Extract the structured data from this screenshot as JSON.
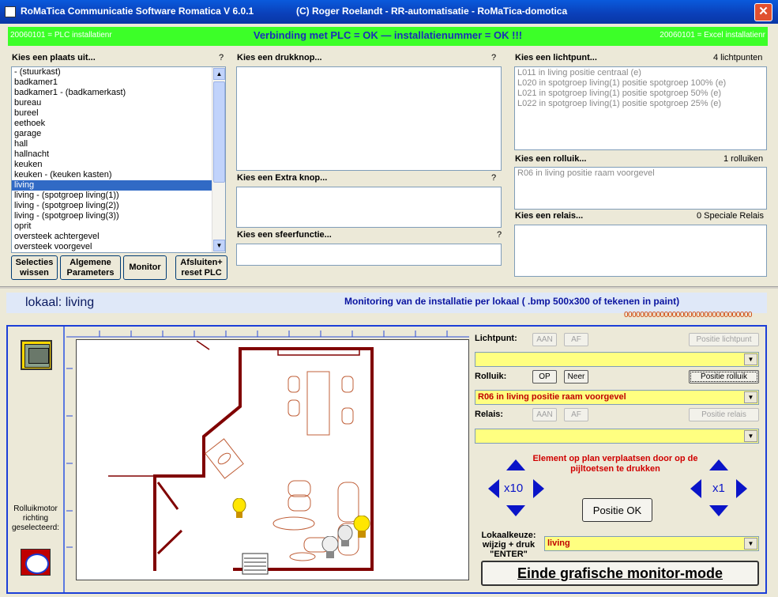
{
  "window": {
    "title_left": "RoMaTica Communicatie Software Romatica V 6.0.1",
    "title_right": "(C) Roger Roelandt - RR-automatisatie - RoMaTica-domotica",
    "close_label": "✕"
  },
  "status": {
    "left": "20060101 = PLC installatienr",
    "center": "Verbinding met PLC = OK  —  installatienummer = OK !!!",
    "right": "20060101 = Excel installatienr"
  },
  "places": {
    "label": "Kies een plaats uit...",
    "help": "?",
    "items": [
      "- (stuurkast)",
      "badkamer1",
      "badkamer1 - (badkamerkast)",
      "bureau",
      "bureel",
      "eethoek",
      "garage",
      "hall",
      "hallnacht",
      "keuken",
      "keuken - (keuken kasten)",
      "living",
      "living - (spotgroep living(1))",
      "living - (spotgroep living(2))",
      "living - (spotgroep living(3))",
      "oprit",
      "oversteek achtergevel",
      "oversteek voorgevel"
    ],
    "selected": "living"
  },
  "buttons": {
    "selecties": "Selecties wissen",
    "algemene": "Algemene Parameters",
    "monitor": "Monitor",
    "afsluiten": "Afsluiten+ reset PLC"
  },
  "drukknop": {
    "label": "Kies een drukknop...",
    "help": "?"
  },
  "extra": {
    "label": "Kies een Extra knop...",
    "help": "?"
  },
  "sfeer": {
    "label": "Kies een sfeerfunctie...",
    "help": "?"
  },
  "lichtpunt": {
    "label": "Kies een lichtpunt...",
    "count": "4 lichtpunten",
    "items": [
      "L011 in living positie centraal (e)",
      "L020 in spotgroep living(1) positie spotgroep 100% (e)",
      "L021 in spotgroep living(1) positie spotgroep 50% (e)",
      "L022 in spotgroep living(1) positie spotgroep 25% (e)"
    ]
  },
  "rolluik": {
    "label": "Kies een rolluik...",
    "count": "1 rolluiken",
    "items": [
      "R06 in living positie raam voorgevel"
    ]
  },
  "relais": {
    "label": "Kies een relais...",
    "count": "0 Speciale Relais"
  },
  "monitor": {
    "lokaal": "lokaal: living",
    "heading": "Monitoring van de installatie per lokaal ( .bmp 500x300 of tekenen in paint)",
    "zeros": "00000000000000000000000000000000",
    "rolluikmotor": "Rolluikmotor richting geselecteerd:"
  },
  "controls": {
    "lichtpunt_label": "Lichtpunt:",
    "aan": "AAN",
    "af": "AF",
    "positie_lichtpunt": "Positie lichtpunt",
    "lichtpunt_value": "",
    "rolluik_label": "Rolluik:",
    "op": "OP",
    "neer": "Neer",
    "positie_rolluik": "Positie rolluik",
    "rolluik_value": "R06 in living positie raam voorgevel",
    "relais_label": "Relais:",
    "positie_relais": "Positie relais",
    "relais_value": "",
    "move_hint": "Element op plan verplaatsen door op de pijltoetsen te drukken",
    "x10": "x10",
    "x1": "x1",
    "positie_ok": "Positie OK",
    "lokaalkeuze": "Lokaalkeuze: wijzig + druk \"ENTER\"",
    "lokaal_value": "living",
    "einde": "Einde grafische monitor-mode"
  },
  "colors": {
    "status_green": "#3cff28",
    "plan_line": "#800000",
    "furniture": "#c0603a",
    "arrow_blue": "#0a14c8",
    "combo_yellow": "#ffff80"
  }
}
